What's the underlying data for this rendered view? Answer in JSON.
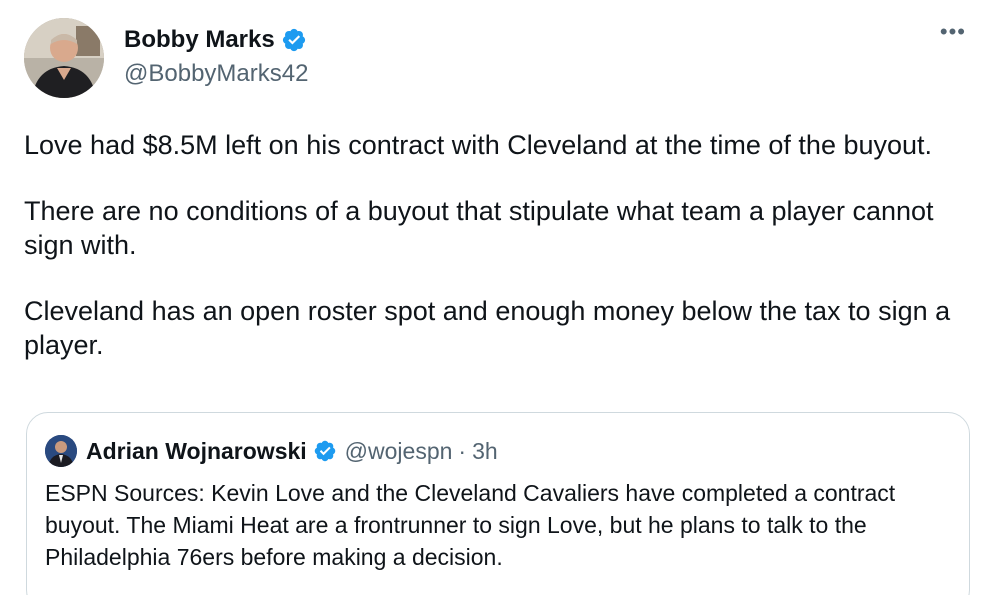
{
  "tweet": {
    "author": {
      "display_name": "Bobby Marks",
      "handle": "@BobbyMarks42",
      "verified_icon": "verified-badge-icon"
    },
    "more_label": "•••",
    "paragraphs": [
      "Love had $8.5M left on his contract with Cleveland at the time of the buyout.",
      "There are no conditions of a buyout that stipulate what team a player cannot sign with.",
      "Cleveland has an open roster spot and enough money below the tax to sign a player."
    ]
  },
  "quote": {
    "author": {
      "display_name": "Adrian Wojnarowski",
      "handle": "@wojespn",
      "separator": "·",
      "time": "3h"
    },
    "text": "ESPN Sources: Kevin Love and the Cleveland Cavaliers have completed a contract buyout. The Miami Heat are a frontrunner to sign Love, but he plans to talk to the Philadelphia 76ers before making a decision."
  },
  "colors": {
    "text_primary": "#0f1419",
    "text_secondary": "#536471",
    "verified_blue": "#1d9bf0",
    "border": "#cfd9de"
  }
}
